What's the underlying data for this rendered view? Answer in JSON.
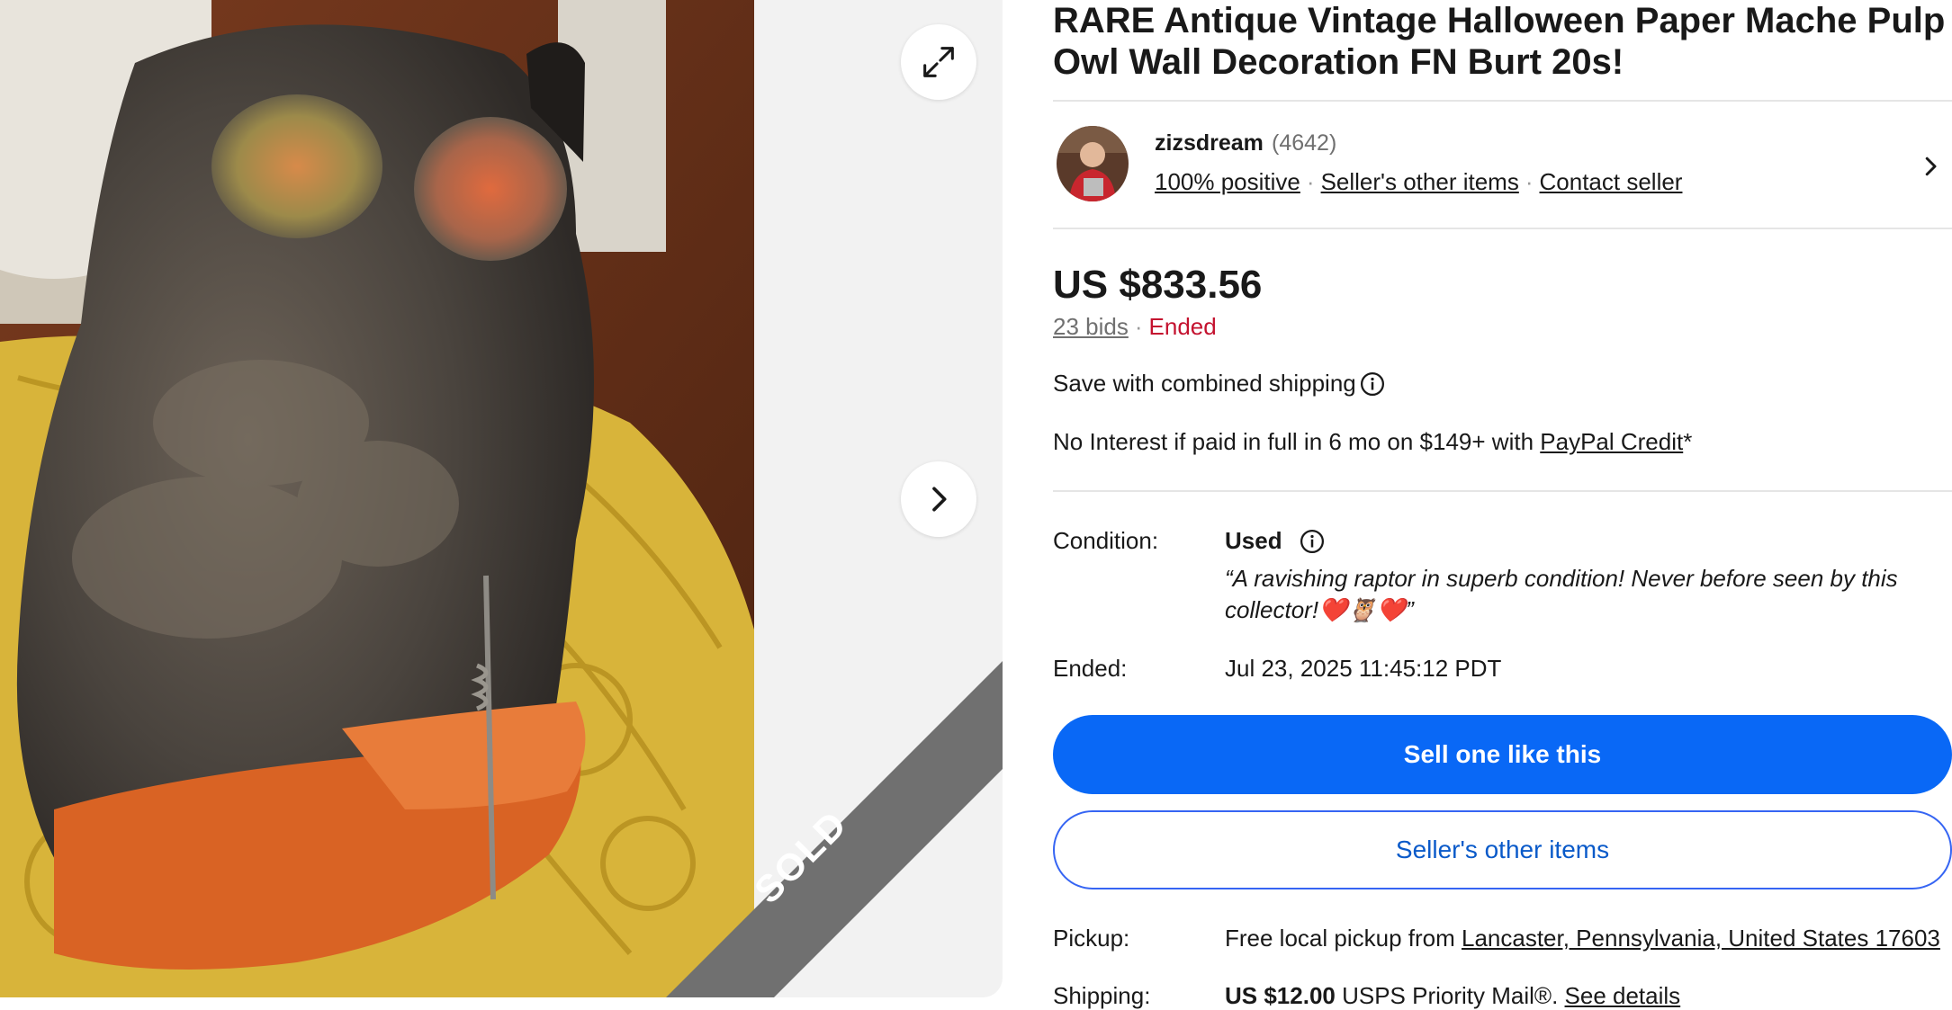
{
  "listing": {
    "title": "RARE Antique Vintage Halloween Paper Mache Pulp Owl Wall Decoration FN Burt 20s!",
    "sold_label": "SOLD"
  },
  "seller": {
    "name": "zizsdream",
    "feedback_count": "(4642)",
    "positive": "100% positive",
    "other_items_link": "Seller's other items",
    "contact_link": "Contact seller"
  },
  "price": {
    "amount": "US $833.56",
    "bids": "23 bids",
    "status": "Ended",
    "combined_shipping": "Save with combined shipping",
    "financing_prefix": "No Interest if paid in full in 6 mo on $149+ with ",
    "financing_link": "PayPal Credit",
    "financing_suffix": "*"
  },
  "details": {
    "condition_label": "Condition:",
    "condition_value": "Used",
    "condition_quote": "“A ravishing raptor in superb condition! Never before seen by this collector!❤️🦉❤️”",
    "ended_label": "Ended:",
    "ended_value": "Jul 23, 2025 11:45:12 PDT",
    "pickup_label": "Pickup:",
    "pickup_prefix": "Free local pickup from ",
    "pickup_location": "Lancaster, Pennsylvania, United States 17603",
    "shipping_label": "Shipping:",
    "shipping_price": "US $12.00",
    "shipping_method": " USPS Priority Mail®. ",
    "shipping_link": "See details"
  },
  "actions": {
    "sell_one": "Sell one like this",
    "sellers_other_items": "Seller's other items"
  },
  "colors": {
    "primary_button": "#0968f6",
    "ended_red": "#c4122f",
    "outline_button_text": "#0a5ac9",
    "sold_ribbon": "#707070"
  },
  "icons": [
    "expand-icon",
    "chevron-right-icon",
    "info-icon"
  ]
}
